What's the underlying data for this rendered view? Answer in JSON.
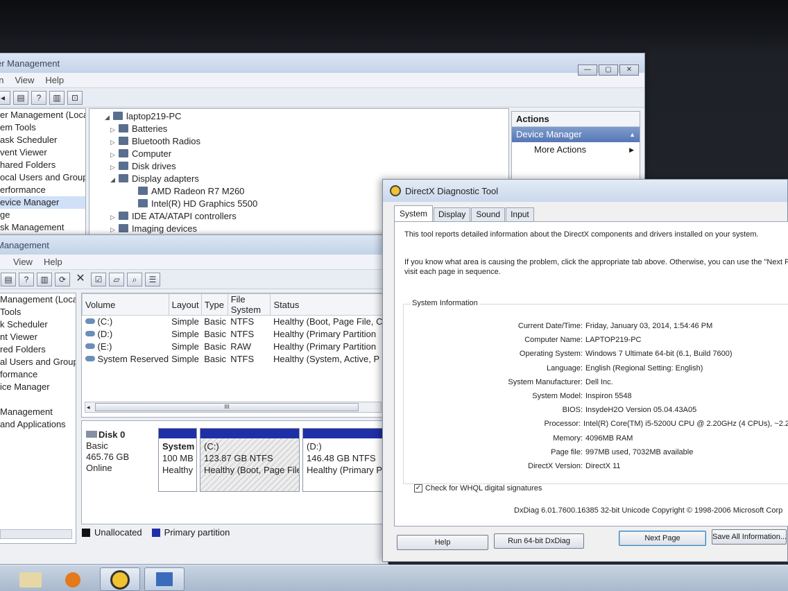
{
  "computer_management_back": {
    "title": "er Management",
    "menu": [
      "on",
      "View",
      "Help"
    ],
    "tree": [
      "er Management (Local",
      "em Tools",
      "ask Scheduler",
      "vent Viewer",
      "hared Folders",
      "ocal Users and Groups",
      "erformance",
      "evice Manager",
      "ge",
      "sk Management"
    ],
    "device_tree": {
      "root": "laptop219-PC",
      "items": [
        {
          "label": "Batteries",
          "expander": "▷",
          "indent": 0
        },
        {
          "label": "Bluetooth Radios",
          "expander": "▷",
          "indent": 0
        },
        {
          "label": "Computer",
          "expander": "▷",
          "indent": 0
        },
        {
          "label": "Disk drives",
          "expander": "▷",
          "indent": 0
        },
        {
          "label": "Display adapters",
          "expander": "◢",
          "indent": 0
        },
        {
          "label": "AMD Radeon R7 M260",
          "expander": "",
          "indent": 1
        },
        {
          "label": "Intel(R) HD Graphics 5500",
          "expander": "",
          "indent": 1
        },
        {
          "label": "IDE ATA/ATAPI controllers",
          "expander": "▷",
          "indent": 0
        },
        {
          "label": "Imaging devices",
          "expander": "▷",
          "indent": 0
        }
      ]
    },
    "actions": {
      "header": "Actions",
      "section": "Device Manager",
      "more": "More Actions"
    }
  },
  "computer_management_front": {
    "title": "Management",
    "menu": [
      "View",
      "Help"
    ],
    "tree": [
      "Management (Local",
      "Tools",
      "k Scheduler",
      "nt Viewer",
      "red Folders",
      "al Users and Groups",
      "formance",
      "ice Manager",
      "",
      "Management",
      "and Applications"
    ],
    "columns": [
      "Volume",
      "Layout",
      "Type",
      "File System",
      "Status"
    ],
    "volumes": [
      {
        "volume": "(C:)",
        "layout": "Simple",
        "type": "Basic",
        "fs": "NTFS",
        "status": "Healthy (Boot, Page File, C"
      },
      {
        "volume": "(D:)",
        "layout": "Simple",
        "type": "Basic",
        "fs": "NTFS",
        "status": "Healthy (Primary Partition"
      },
      {
        "volume": "(E:)",
        "layout": "Simple",
        "type": "Basic",
        "fs": "RAW",
        "status": "Healthy (Primary Partition"
      },
      {
        "volume": "System Reserved",
        "layout": "Simple",
        "type": "Basic",
        "fs": "NTFS",
        "status": "Healthy (System, Active, P"
      }
    ],
    "scroll_grip": "III",
    "disk": {
      "name": "Disk 0",
      "type": "Basic",
      "size": "465.76 GB",
      "state": "Online"
    },
    "partitions": [
      {
        "name": "System",
        "size": "100 MB",
        "status": "Healthy"
      },
      {
        "name": "(C:)",
        "size": "123.87 GB NTFS",
        "status": "Healthy (Boot, Page File"
      },
      {
        "name": "(D:)",
        "size": "146.48 GB NTFS",
        "status": "Healthy (Primary Pa"
      }
    ],
    "legend": [
      {
        "label": "Unallocated",
        "color": "#111111"
      },
      {
        "label": "Primary partition",
        "color": "#1f2fa8"
      }
    ]
  },
  "dxdiag": {
    "title": "DirectX Diagnostic Tool",
    "tabs": [
      "System",
      "Display",
      "Sound",
      "Input"
    ],
    "intro1": "This tool reports detailed information about the DirectX components and drivers installed on your system.",
    "intro2a": "If you know what area is causing the problem, click the appropriate tab above.  Otherwise, you can use the \"Next P",
    "intro2b": "visit each page in sequence.",
    "section": "System Information",
    "info": [
      {
        "k": "Current Date/Time:",
        "v": "Friday, January 03, 2014, 1:54:46 PM"
      },
      {
        "k": "Computer Name:",
        "v": "LAPTOP219-PC"
      },
      {
        "k": "Operating System:",
        "v": "Windows 7 Ultimate 64-bit (6.1, Build 7600)"
      },
      {
        "k": "Language:",
        "v": "English (Regional Setting: English)"
      },
      {
        "k": "System Manufacturer:",
        "v": "Dell Inc."
      },
      {
        "k": "System Model:",
        "v": "Inspiron 5548"
      },
      {
        "k": "BIOS:",
        "v": "InsydeH2O Version 05.04.43A05"
      },
      {
        "k": "Processor:",
        "v": "Intel(R) Core(TM) i5-5200U CPU @ 2.20GHz (4 CPUs), ~2.2"
      },
      {
        "k": "Memory:",
        "v": "4096MB RAM"
      },
      {
        "k": "Page file:",
        "v": "997MB used, 7032MB available"
      },
      {
        "k": "DirectX Version:",
        "v": "DirectX 11"
      }
    ],
    "whql": "Check for WHQL digital signatures",
    "footer": "DxDiag 6.01.7600.16385 32-bit Unicode  Copyright © 1998-2006 Microsoft Corp",
    "buttons": {
      "help": "Help",
      "run64": "Run 64-bit DxDiag",
      "next": "Next Page",
      "save": "Save All Information..."
    }
  },
  "window_controls": {
    "minimize": "—",
    "maximize": "▢",
    "close": "✕"
  }
}
